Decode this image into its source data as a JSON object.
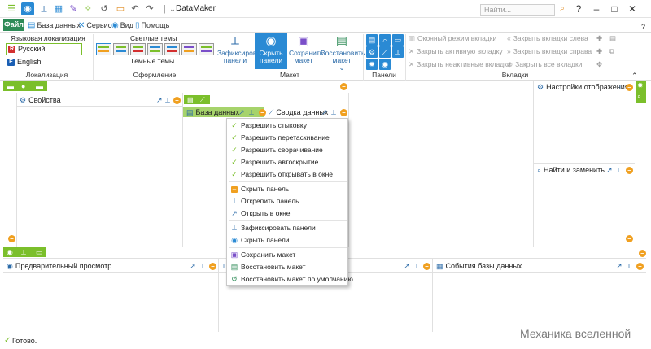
{
  "app": {
    "title": "DataMaker",
    "search_placeholder": "Найти...",
    "help": "?",
    "help_bottom": "?"
  },
  "menu": {
    "file": "Файл",
    "tabs": [
      {
        "label": "База данных"
      },
      {
        "label": "Сервис"
      },
      {
        "label": "Вид"
      },
      {
        "label": "Помощь"
      }
    ]
  },
  "ribbon": {
    "localization": {
      "title": "Языковая локализация",
      "languages": [
        {
          "label": "Русский",
          "flag": "R"
        },
        {
          "label": "English",
          "flag": "E"
        }
      ],
      "group_label": "Локализация"
    },
    "themes": {
      "light_title": "Светлые темы",
      "dark_title": "Тёмные темы",
      "group_label": "Оформление"
    },
    "layout": {
      "buttons": [
        {
          "label": "Зафиксировать панели"
        },
        {
          "label": "Скрыть панели"
        },
        {
          "label": "Сохранить макет"
        },
        {
          "label": "Восстановить макет"
        }
      ],
      "group_label": "Макет"
    },
    "panels": {
      "group_label": "Панели"
    },
    "tabs": {
      "items": [
        "Оконный режим вкладки",
        "Закрыть активную вкладку",
        "Закрыть неактивные вкладки",
        "Закрыть вкладки слева",
        "Закрыть вкладки справа",
        "Закрыть все вкладки"
      ],
      "group_label": "Вкладки"
    }
  },
  "panels": {
    "properties": "Свойства",
    "database": "База данных",
    "data_summary": "Сводка данных",
    "display_settings": "Настройки отображения",
    "find_replace": "Найти и заменить",
    "preview": "Предварительный просмотр",
    "db_events": "События базы данных"
  },
  "context_menu": {
    "items": [
      {
        "label": "Разрешить стыковку",
        "icon": "check-icon"
      },
      {
        "label": "Разрешить перетаскивание",
        "icon": "check-icon"
      },
      {
        "label": "Разрешить сворачивание",
        "icon": "check-icon"
      },
      {
        "label": "Разрешить автоскрытие",
        "icon": "check-icon"
      },
      {
        "label": "Разрешить открывать в окне",
        "icon": "check-icon"
      },
      {
        "label": "Скрыть панель",
        "icon": "minus-icon"
      },
      {
        "label": "Открепить панель",
        "icon": "pin-icon"
      },
      {
        "label": "Открыть в окне",
        "icon": "arrow-icon"
      },
      {
        "label": "Зафиксировать панели",
        "icon": "pin-icon"
      },
      {
        "label": "Скрыть панели",
        "icon": "eye-icon"
      },
      {
        "label": "Сохранить макет",
        "icon": "save-icon"
      },
      {
        "label": "Восстановить макет",
        "icon": "restore-icon"
      },
      {
        "label": "Восстановить макет по умолчанию",
        "icon": "reset-icon"
      }
    ]
  },
  "status": {
    "text": "Готово."
  },
  "watermark": "Механика вселенной",
  "colors": {
    "accent": "#2a8ad4",
    "green": "#7bbf2b",
    "orange": "#f0a020",
    "file_tab": "#2e8b57"
  }
}
